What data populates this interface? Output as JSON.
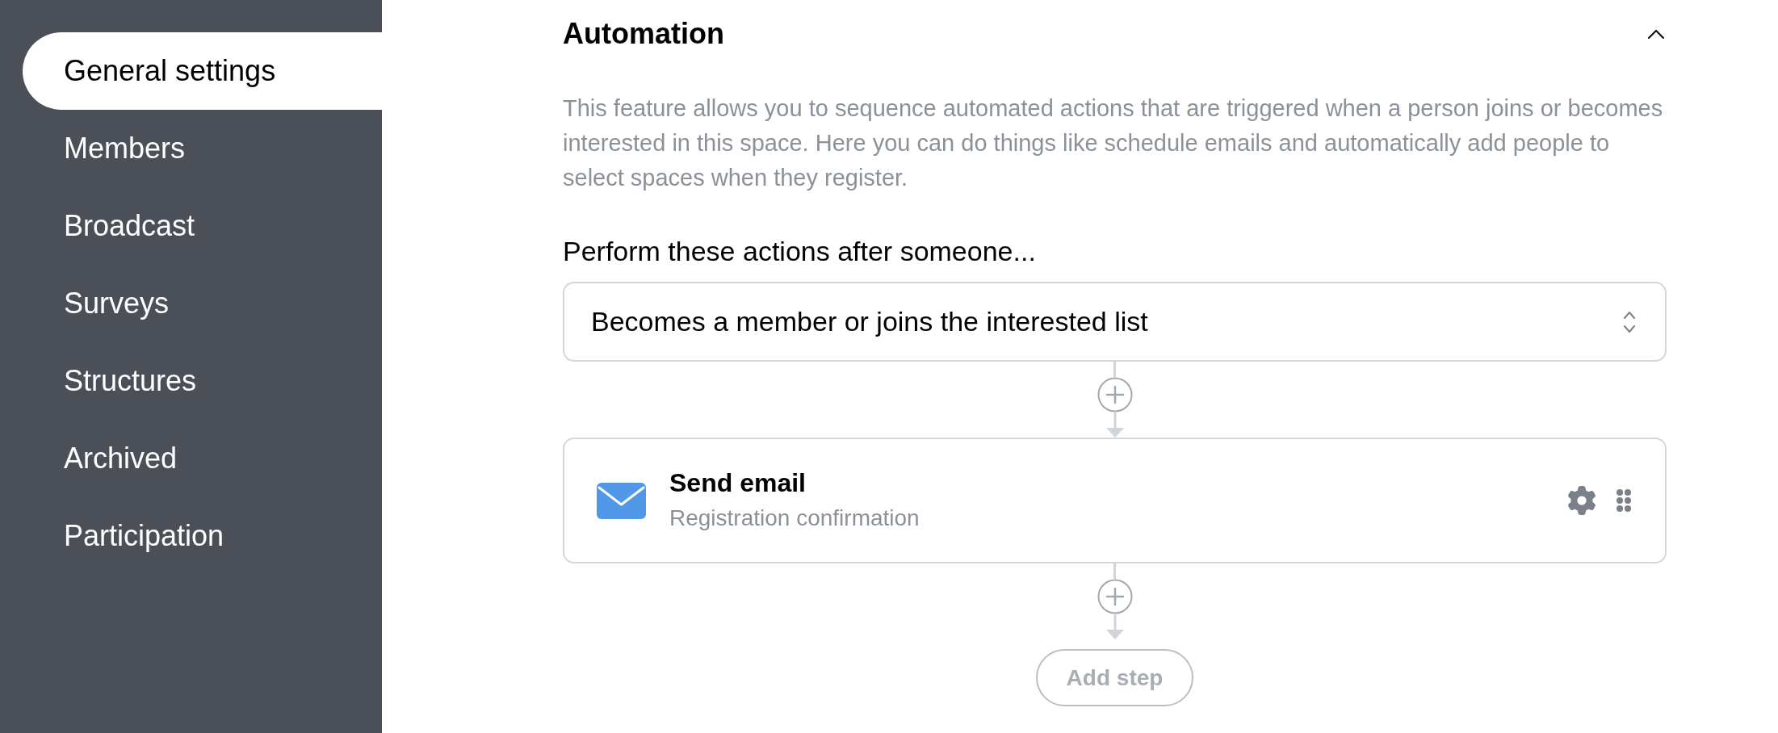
{
  "sidebar": {
    "items": [
      {
        "label": "General settings",
        "selected": true
      },
      {
        "label": "Members",
        "selected": false
      },
      {
        "label": "Broadcast",
        "selected": false
      },
      {
        "label": "Surveys",
        "selected": false
      },
      {
        "label": "Structures",
        "selected": false
      },
      {
        "label": "Archived",
        "selected": false
      },
      {
        "label": "Participation",
        "selected": false
      }
    ]
  },
  "section": {
    "title": "Automation",
    "expanded": true,
    "description": "This feature allows you to sequence automated actions that are triggered when a person joins or becomes interested in this space. Here you can do things like schedule emails and automatically add people to select spaces when they register."
  },
  "trigger": {
    "label": "Perform these actions after someone...",
    "value": "Becomes a member or joins the interested list"
  },
  "steps": [
    {
      "kind": "email",
      "title": "Send email",
      "subtitle": "Registration confirmation"
    }
  ],
  "add_step_button": "Add step"
}
